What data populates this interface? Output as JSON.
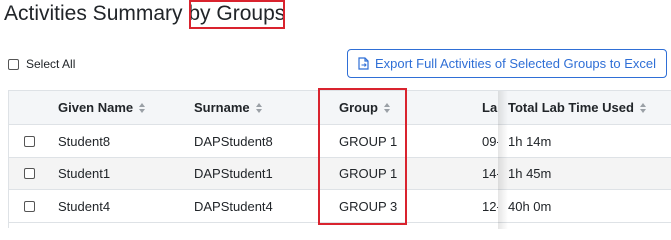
{
  "page": {
    "title": "Activities Summary by Groups"
  },
  "controls": {
    "select_all_label": "Select All",
    "export_button_label": "Export Full Activities of Selected Groups to Excel",
    "export_icon": "file-export-icon"
  },
  "table": {
    "columns": [
      "Given Name",
      "Surname",
      "Group",
      "La",
      "Total Lab Time Used"
    ],
    "rows": [
      {
        "given_name": "Student8",
        "surname": "DAPStudent8",
        "group": "GROUP 1",
        "last": "09-",
        "total_lab_time": "1h 14m"
      },
      {
        "given_name": "Student1",
        "surname": "DAPStudent1",
        "group": "GROUP 1",
        "last": "14-",
        "total_lab_time": "1h 45m"
      },
      {
        "given_name": "Student4",
        "surname": "DAPStudent4",
        "group": "GROUP 3",
        "last": "12-",
        "total_lab_time": "40h 0m"
      }
    ]
  },
  "colors": {
    "highlight": "#d9232e",
    "accent": "#2f6fd6"
  }
}
